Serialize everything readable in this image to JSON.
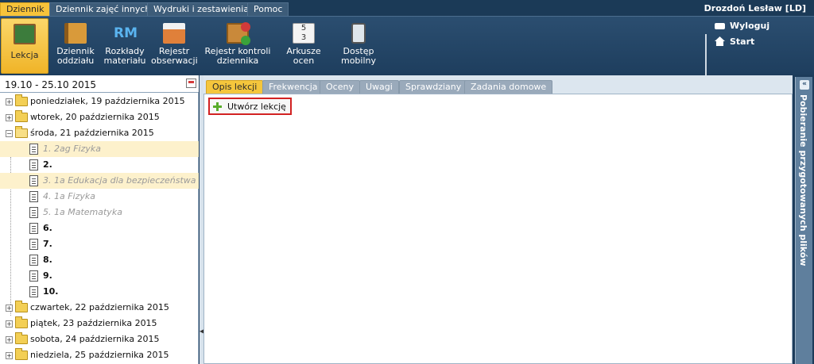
{
  "menu": {
    "tabs": [
      {
        "label": "Dziennik"
      },
      {
        "label": "Dziennik zajęć innych"
      },
      {
        "label": "Wydruki i zestawienia"
      },
      {
        "label": "Pomoc"
      }
    ],
    "user": "Drozdoń Lesław [LD]"
  },
  "ribbon": {
    "buttons": [
      {
        "label": "Lekcja",
        "icon": "chalkboard-icon"
      },
      {
        "label": "Dziennik oddziału",
        "icon": "book-icon"
      },
      {
        "label": "Rozkłady materiału",
        "icon": "rm-icon"
      },
      {
        "label": "Rejestr obserwacji",
        "icon": "calendar-folder-icon"
      },
      {
        "label": "Rejestr kontroli dziennika",
        "icon": "audit-icon"
      },
      {
        "label": "Arkusze ocen",
        "icon": "grades-sheet-icon"
      },
      {
        "label": "Dostęp mobilny",
        "icon": "phone-icon"
      }
    ],
    "side_links": [
      {
        "label": "Wyloguj",
        "icon": "lock-icon"
      },
      {
        "label": "Start",
        "icon": "home-icon"
      }
    ]
  },
  "left": {
    "date_range": "19.10 - 25.10 2015",
    "tree": {
      "days_before": [
        {
          "label": "poniedziałek, 19 października 2015"
        },
        {
          "label": "wtorek, 20 października 2015"
        }
      ],
      "open_day": "środa, 21 października 2015",
      "lessons": [
        {
          "label": "1. 2ag Fizyka",
          "style": "ital",
          "highlight": true
        },
        {
          "label": "2.",
          "style": "bold",
          "highlight": false
        },
        {
          "label": "3. 1a Edukacja dla bezpieczeństwa",
          "style": "ital",
          "highlight": true
        },
        {
          "label": "4. 1a Fizyka",
          "style": "ital",
          "highlight": false
        },
        {
          "label": "5. 1a Matematyka",
          "style": "ital",
          "highlight": false
        },
        {
          "label": "6.",
          "style": "bold",
          "highlight": false
        },
        {
          "label": "7.",
          "style": "bold",
          "highlight": false
        },
        {
          "label": "8.",
          "style": "bold",
          "highlight": false
        },
        {
          "label": "9.",
          "style": "bold",
          "highlight": false
        },
        {
          "label": "10.",
          "style": "bold",
          "highlight": false
        }
      ],
      "days_after": [
        {
          "label": "czwartek, 22 października 2015"
        },
        {
          "label": "piątek, 23 października 2015"
        },
        {
          "label": "sobota, 24 października 2015"
        },
        {
          "label": "niedziela, 25 października 2015"
        }
      ]
    }
  },
  "main": {
    "tabs": [
      {
        "label": "Opis lekcji"
      },
      {
        "label": "Frekwencja"
      },
      {
        "label": "Oceny"
      },
      {
        "label": "Uwagi"
      },
      {
        "label": "Sprawdziany"
      },
      {
        "label": "Zadania domowe"
      }
    ],
    "create_button": "Utwórz lekcję"
  },
  "right_panel": {
    "title": "Pobieranie przygotowanych plików"
  }
}
